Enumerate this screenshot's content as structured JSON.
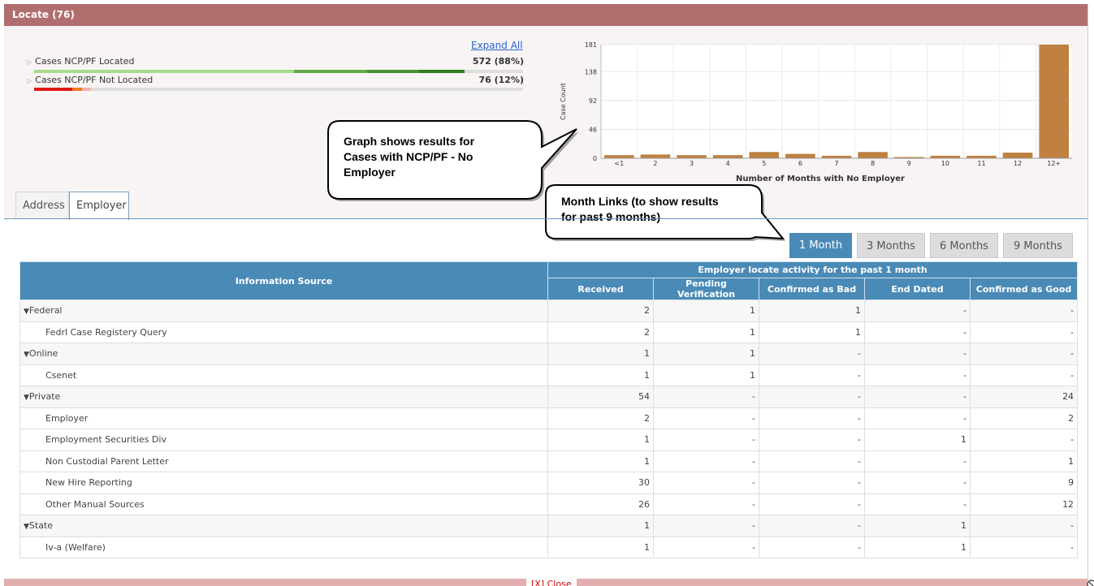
{
  "header": {
    "title": "Locate (76)"
  },
  "summary": {
    "expand_all_label": "Expand All",
    "located": {
      "label": "Cases NCP/PF Located",
      "value": "572 (88%)"
    },
    "not_located": {
      "label": "Cases NCP/PF Not Located",
      "value": "76 (12%)"
    },
    "colors": {
      "located_segments": [
        "#a6dc8c",
        "#5fab48",
        "#469033",
        "#2f7d1e"
      ],
      "not_located_segments": [
        "#e01818",
        "#f07a1c",
        "#f4b2a8"
      ]
    }
  },
  "chart_data": {
    "type": "bar",
    "categories": [
      "<1",
      "2",
      "3",
      "4",
      "5",
      "6",
      "7",
      "8",
      "9",
      "10",
      "11",
      "12",
      "12+"
    ],
    "values": [
      5,
      6,
      5,
      5,
      10,
      7,
      4,
      10,
      2,
      4,
      4,
      9,
      181
    ],
    "xlabel": "Number of Months with No Employer",
    "ylabel": "Case Count",
    "ylim": [
      0,
      181
    ],
    "yticks": [
      0,
      46,
      92,
      138,
      181
    ],
    "grid": true,
    "bar_color": "#bf8040"
  },
  "callouts": {
    "graph_note": {
      "lines": [
        "Graph shows results for",
        "Cases with NCP/PF - No",
        "Employer"
      ]
    },
    "month_note": {
      "lines": [
        "Month Links (to show results",
        "for past 9 months)"
      ]
    }
  },
  "tabs": [
    {
      "label": "Address",
      "active": false
    },
    {
      "label": "Employer",
      "active": true
    }
  ],
  "month_links": [
    {
      "label": "1  Month",
      "active": true
    },
    {
      "label": "3  Months",
      "active": false
    },
    {
      "label": "6  Months",
      "active": false
    },
    {
      "label": "9  Months",
      "active": false
    }
  ],
  "table": {
    "source_header": "Information Source",
    "group_header": "Employer locate activity for the past 1 month",
    "columns": [
      "Received",
      "Pending Verification",
      "Confirmed as Bad",
      "End Dated",
      "Confirmed as Good"
    ],
    "rows": [
      {
        "label": "Federal",
        "group": true,
        "values": [
          "2",
          "1",
          "1",
          "-",
          "-"
        ]
      },
      {
        "label": "Fedrl Case Registery Query",
        "group": false,
        "values": [
          "2",
          "1",
          "1",
          "-",
          "-"
        ]
      },
      {
        "label": "Online",
        "group": true,
        "values": [
          "1",
          "1",
          "-",
          "-",
          "-"
        ]
      },
      {
        "label": "Csenet",
        "group": false,
        "values": [
          "1",
          "1",
          "-",
          "-",
          "-"
        ]
      },
      {
        "label": "Private",
        "group": true,
        "values": [
          "54",
          "-",
          "-",
          "-",
          "24"
        ]
      },
      {
        "label": "Employer",
        "group": false,
        "values": [
          "2",
          "-",
          "-",
          "-",
          "2"
        ]
      },
      {
        "label": "Employment Securities Div",
        "group": false,
        "values": [
          "1",
          "-",
          "-",
          "1",
          "-"
        ]
      },
      {
        "label": "Non Custodial Parent Letter",
        "group": false,
        "values": [
          "1",
          "-",
          "-",
          "-",
          "1"
        ]
      },
      {
        "label": "New Hire Reporting",
        "group": false,
        "values": [
          "30",
          "-",
          "-",
          "-",
          "9"
        ]
      },
      {
        "label": "Other Manual Sources",
        "group": false,
        "values": [
          "26",
          "-",
          "-",
          "-",
          "12"
        ]
      },
      {
        "label": "State",
        "group": true,
        "values": [
          "1",
          "-",
          "-",
          "1",
          "-"
        ]
      },
      {
        "label": "Iv-a (Welfare)",
        "group": false,
        "values": [
          "1",
          "-",
          "-",
          "1",
          "-"
        ]
      }
    ]
  },
  "footer": {
    "close_label": "[X] Close"
  }
}
